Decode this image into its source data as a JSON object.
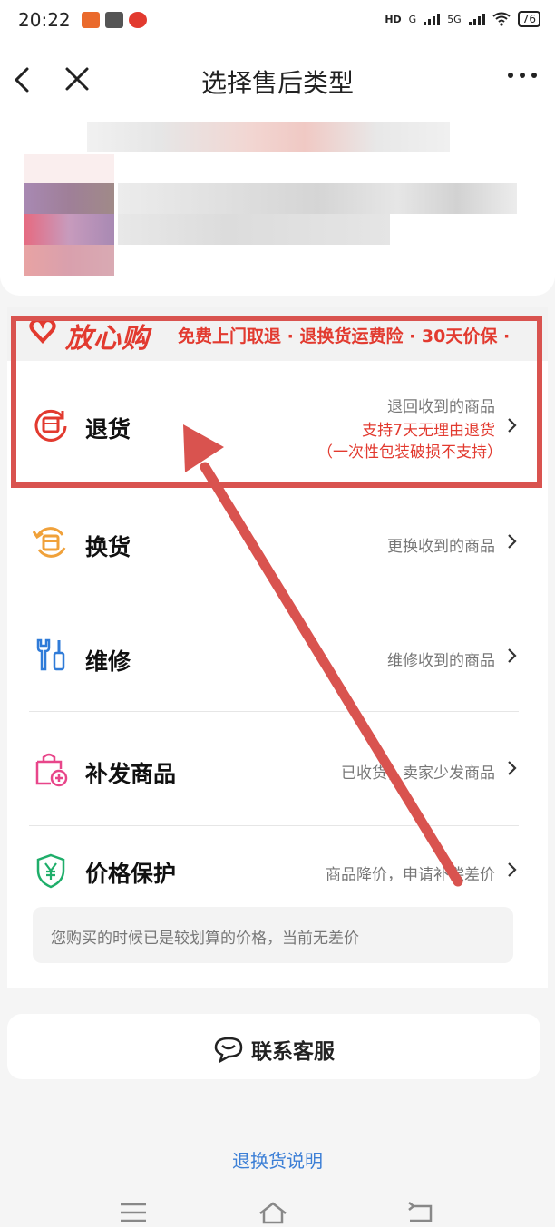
{
  "status": {
    "time": "20:22",
    "signal1": "G",
    "signal2": "5G",
    "hd": "HD",
    "battery": "76"
  },
  "nav": {
    "title": "选择售后类型"
  },
  "worry_free": {
    "brand": "放心购",
    "text": "免费上门取退 · 退换货运费险 · 30天价保 ·"
  },
  "options": [
    {
      "label": "退货",
      "desc": "退回收到的商品",
      "promo1": "支持7天无理由退货",
      "promo2": "（一次性包装破损不支持）",
      "icon": "return-icon"
    },
    {
      "label": "换货",
      "desc": "更换收到的商品",
      "icon": "exchange-icon"
    },
    {
      "label": "维修",
      "desc": "维修收到的商品",
      "icon": "repair-icon"
    },
    {
      "label": "补发商品",
      "desc": "已收货，卖家少发商品",
      "icon": "reissue-icon"
    },
    {
      "label": "价格保护",
      "desc": "商品降价，申请补偿差价",
      "icon": "price-protect-icon"
    }
  ],
  "price_note": "您购买的时候已是较划算的价格，当前无差价",
  "contact_label": "联系客服",
  "explain_link": "退换货说明",
  "colors": {
    "accent_red": "#e23a2f",
    "link_blue": "#3c7fd6",
    "annotation": "#d9534f"
  }
}
